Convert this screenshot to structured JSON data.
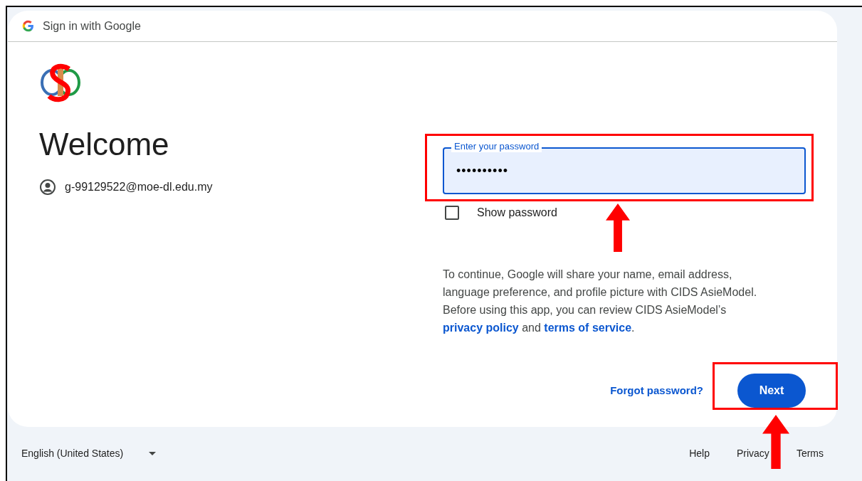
{
  "header": {
    "title": "Sign in with Google"
  },
  "welcome": {
    "heading": "Welcome",
    "account": "g-99129522@moe-dl.edu.my"
  },
  "password_field": {
    "label": "Enter your password",
    "value": "••••••••••",
    "focused": true
  },
  "show_password": {
    "label": "Show password",
    "checked": false
  },
  "consent": [
    {
      "kind": "text",
      "text": "To continue, Google will share your name, email address, language preference, and profile picture with CIDS AsieModel. Before using this app, you can review CIDS AsieModel’s "
    },
    {
      "kind": "link",
      "text": "privacy policy"
    },
    {
      "kind": "text",
      "text": " and "
    },
    {
      "kind": "link",
      "text": "terms of service"
    },
    {
      "kind": "text",
      "text": "."
    }
  ],
  "actions": {
    "forgot": "Forgot password?",
    "next": "Next"
  },
  "footer": {
    "language": "English (United States)",
    "links": [
      "Help",
      "Privacy",
      "Terms"
    ]
  }
}
